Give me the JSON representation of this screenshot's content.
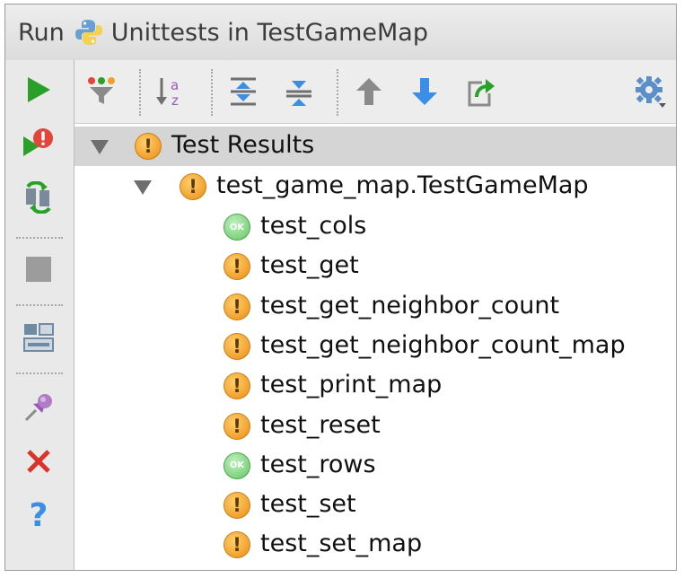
{
  "titlebar": {
    "run_label": "Run",
    "config_name": "Unittests in TestGameMap"
  },
  "left_toolbar": {
    "icons": [
      "run-icon",
      "rerun-failed-icon",
      "toggle-auto-test-icon",
      "stop-icon",
      "layout-icon",
      "pin-icon",
      "close-icon",
      "help-icon"
    ],
    "help_glyph": "?",
    "close_glyph": "✕"
  },
  "top_toolbar": {
    "icons": [
      "filter-icon",
      "sort-alpha-icon",
      "expand-all-icon",
      "collapse-all-icon",
      "previous-failed-icon",
      "next-failed-icon",
      "export-icon",
      "settings-icon"
    ],
    "sort_glyph_a": "a",
    "sort_glyph_z": "z"
  },
  "tree": {
    "root": {
      "label": "Test Results",
      "status": "warning",
      "glyph": "!"
    },
    "suite": {
      "label": "test_game_map.TestGameMap",
      "status": "warning",
      "glyph": "!"
    },
    "tests": [
      {
        "label": "test_cols",
        "status": "ok",
        "glyph": "OK"
      },
      {
        "label": "test_get",
        "status": "warning",
        "glyph": "!"
      },
      {
        "label": "test_get_neighbor_count",
        "status": "warning",
        "glyph": "!"
      },
      {
        "label": "test_get_neighbor_count_map",
        "status": "warning",
        "glyph": "!"
      },
      {
        "label": "test_print_map",
        "status": "warning",
        "glyph": "!"
      },
      {
        "label": "test_reset",
        "status": "warning",
        "glyph": "!"
      },
      {
        "label": "test_rows",
        "status": "ok",
        "glyph": "OK"
      },
      {
        "label": "test_set",
        "status": "warning",
        "glyph": "!"
      },
      {
        "label": "test_set_map",
        "status": "warning",
        "glyph": "!"
      }
    ]
  },
  "colors": {
    "warning": "#f2a02c",
    "ok": "#7fd37f",
    "run_green": "#2aa02a",
    "nav_blue": "#3a8ee6",
    "stop_red": "#d9332a"
  }
}
